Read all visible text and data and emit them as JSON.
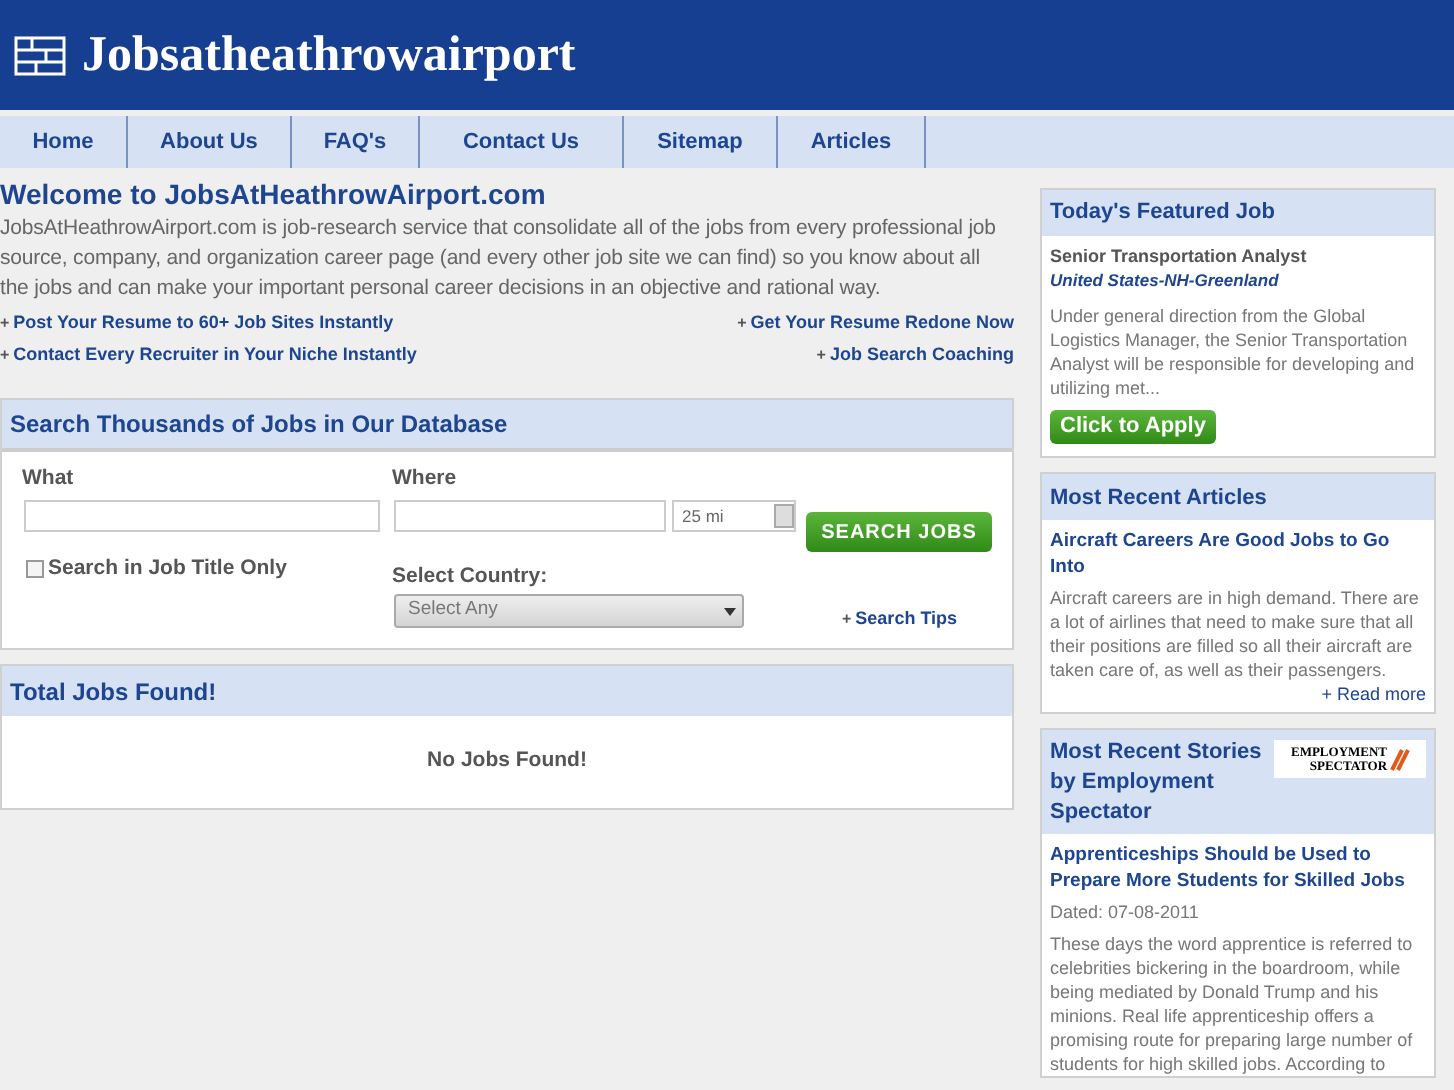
{
  "site_title": "Jobsatheathrowairport",
  "nav": [
    {
      "label": "Home"
    },
    {
      "label": "About Us"
    },
    {
      "label": "FAQ's"
    },
    {
      "label": "Contact Us"
    },
    {
      "label": "Sitemap"
    },
    {
      "label": "Articles"
    }
  ],
  "welcome": {
    "heading": "Welcome to JobsAtHeathrowAirport.com",
    "text": "JobsAtHeathrowAirport.com is job-research service that consolidate all of the jobs from every professional job source, company, and organization career page (and every other job site we can find) so you know about all the jobs and can make your important personal career decisions in an objective and rational way.",
    "links": [
      {
        "mark": "+",
        "label": "Post Your Resume to 60+ Job Sites Instantly"
      },
      {
        "mark": "+",
        "label": "Get Your Resume Redone Now"
      },
      {
        "mark": "+",
        "label": "Contact Every Recruiter in Your Niche Instantly"
      },
      {
        "mark": "+",
        "label": "Job Search Coaching"
      }
    ]
  },
  "search": {
    "heading": "Search Thousands of Jobs in Our Database",
    "what_label": "What",
    "where_label": "Where",
    "distance": "25 mi",
    "button": "SEARCH JOBS",
    "title_only": {
      "label": "Search in Job Title Only",
      "checked": false
    },
    "country_label": "Select Country:",
    "country": "Select Any",
    "tips": {
      "mark": "+",
      "label": "Search Tips"
    }
  },
  "results": {
    "heading": "Total Jobs Found!",
    "message": "No Jobs Found!"
  },
  "featured": {
    "heading": "Today's Featured Job",
    "title": "Senior Transportation Analyst",
    "location": "United States-NH-Greenland",
    "description": "Under general direction from the Global Logistics Manager, the Senior Transportation Analyst will be responsible for developing and utilizing met...",
    "button": "Click to Apply"
  },
  "articles": {
    "heading": "Most Recent Articles",
    "title": "Aircraft Careers Are Good Jobs to Go Into",
    "text": "Aircraft careers are in high demand. There are a lot of airlines that need to make sure that all their positions are filled so all their aircraft are taken care of, as well as their passengers.",
    "more": "+ Read more"
  },
  "stories": {
    "heading": "Most Recent Stories by Employment Spectator",
    "logo": [
      "EMPLOYMENT",
      "SPECTATOR"
    ],
    "title": "Apprenticeships Should be Used to Prepare More Students for Skilled Jobs",
    "dated": "Dated: 07-08-2011",
    "text": "These days the word apprentice is referred to celebrities bickering in the boardroom, while being mediated by Donald Trump and his minions. Real life apprenticeship offers a promising route for preparing large number of students for high skilled jobs. According to"
  }
}
